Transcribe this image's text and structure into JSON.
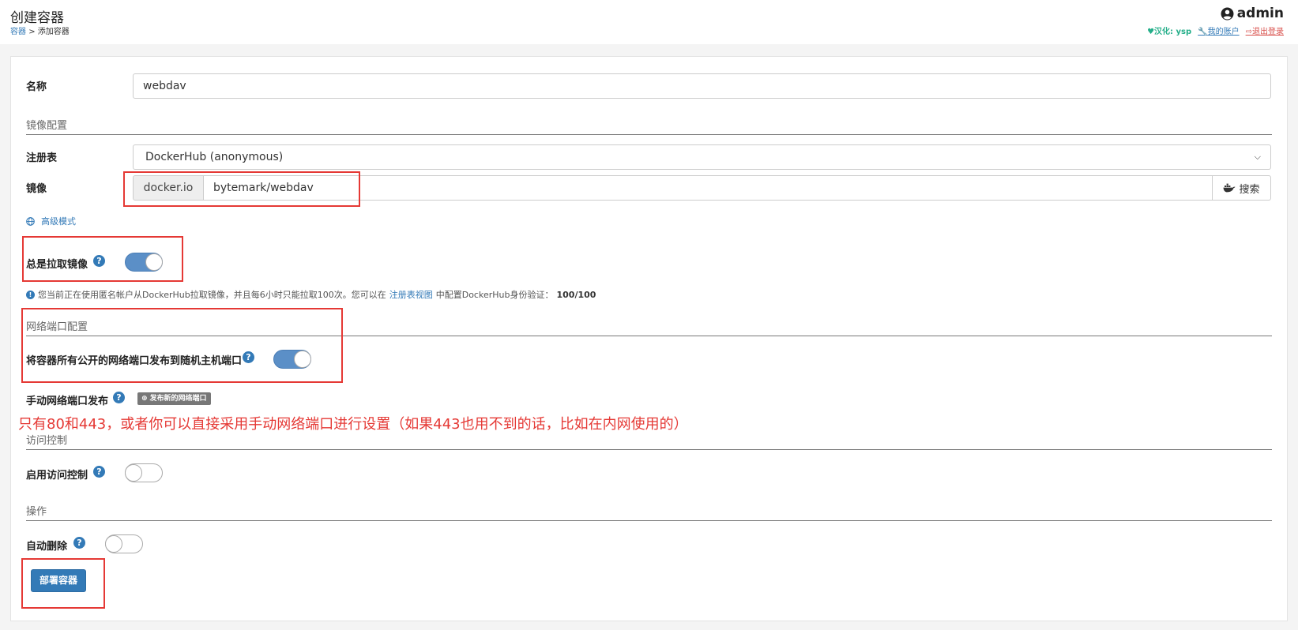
{
  "header": {
    "title": "创建容器",
    "breadcrumb_link": "容器",
    "breadcrumb_sep": ">",
    "breadcrumb_current": "添加容器",
    "user": "admin",
    "translation": "汉化: ysp",
    "my_account": "我的账户",
    "logout": "退出登录"
  },
  "form": {
    "name_label": "名称",
    "name_value": "webdav",
    "image_section": "镜像配置",
    "registry_label": "注册表",
    "registry_value": "DockerHub (anonymous)",
    "image_label": "镜像",
    "image_prefix": "docker.io",
    "image_value": "bytemark/webdav",
    "search_label": "搜索",
    "advanced_mode": "高级模式",
    "always_pull_label": "总是拉取镜像",
    "always_pull_on": true,
    "info_text": "您当前正在使用匿名帐户从DockerHub拉取镜像，并且每6小时只能拉取100次。您可以在",
    "info_link": "注册表视图",
    "info_text2": "中配置DockerHub身份验证：",
    "info_quota": "100/100",
    "network_section": "网络端口配置",
    "publish_all_label": "将容器所有公开的网络端口发布到随机主机端口",
    "publish_all_on": true,
    "manual_label": "手动网络端口发布",
    "publish_new_btn": "发布新的网络端口",
    "annotation": "只有80和443，或者你可以直接采用手动网络端口进行设置（如果443也用不到的话，比如在内网使用的）",
    "access_section": "访问控制",
    "access_label": "启用访问控制",
    "access_on": false,
    "actions_section": "操作",
    "autoremove_label": "自动删除",
    "autoremove_on": false,
    "deploy_btn": "部署容器"
  },
  "icons": {
    "help": "question-circle-icon",
    "user": "user-circle-icon",
    "globe": "globe-icon",
    "info": "info-circle-icon",
    "docker": "docker-whale-icon"
  },
  "colors": {
    "primary": "#337ab7",
    "annotation_red": "#e53935",
    "toggle_on": "#5b8fc7"
  }
}
